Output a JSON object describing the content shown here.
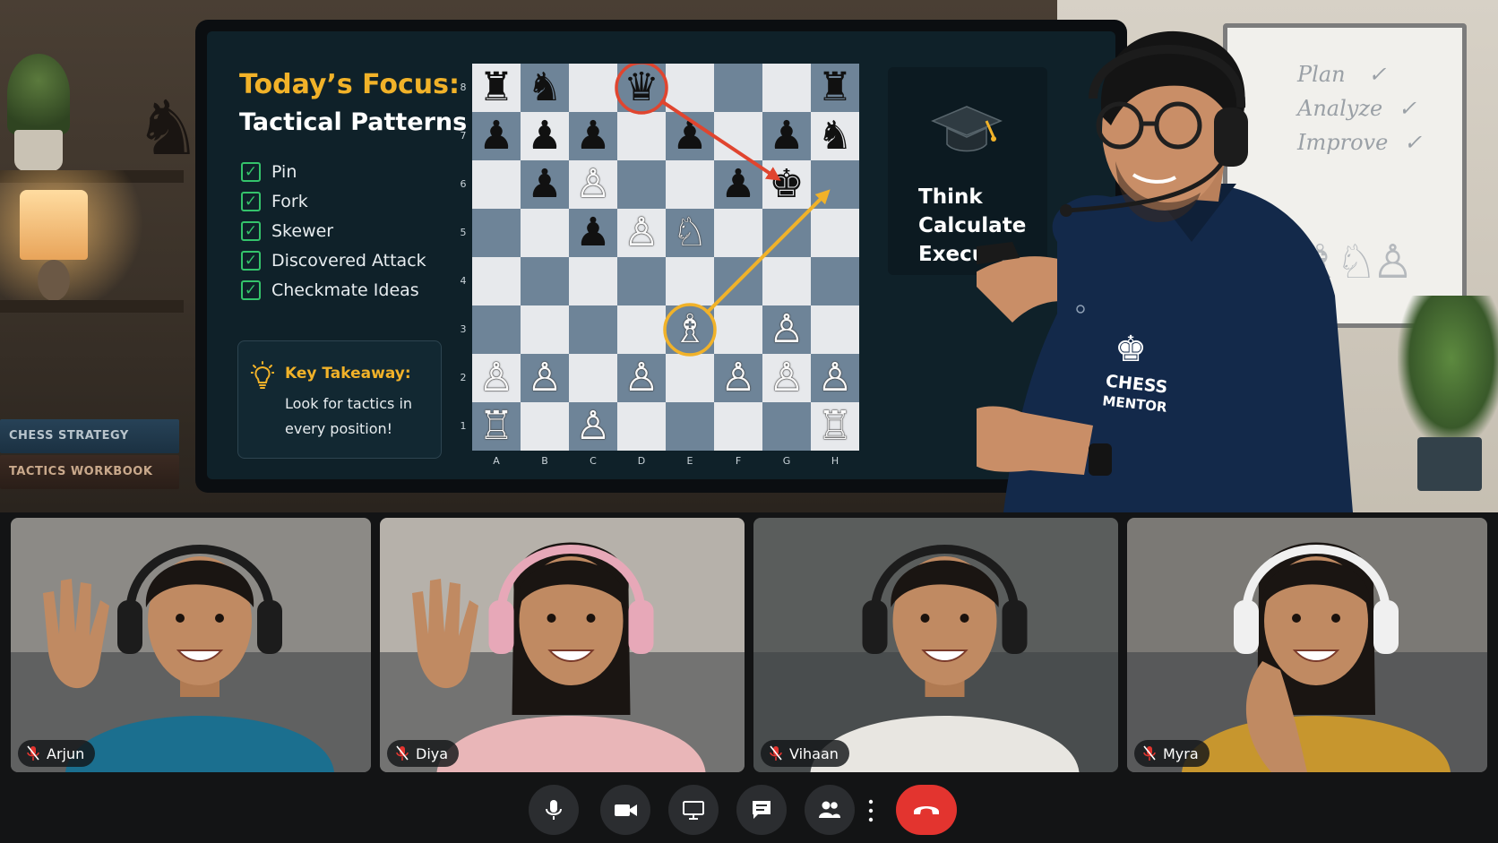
{
  "lesson": {
    "title": "Today’s Focus:",
    "subtitle": "Tactical Patterns",
    "topics": [
      "Pin",
      "Fork",
      "Skewer",
      "Discovered Attack",
      "Checkmate Ideas"
    ],
    "takeaway_title": "Key Takeaway:",
    "takeaway_body": "Look for tactics in every position!",
    "mantra": [
      "Think",
      "Calculate",
      "Execute"
    ]
  },
  "board": {
    "files": [
      "A",
      "B",
      "C",
      "D",
      "E",
      "F",
      "G",
      "H"
    ],
    "ranks": [
      "8",
      "7",
      "6",
      "5",
      "4",
      "3",
      "2",
      "1"
    ],
    "pieces": [
      {
        "sq": "a8",
        "glyph": "♜",
        "color": "b"
      },
      {
        "sq": "b8",
        "glyph": "♞",
        "color": "b"
      },
      {
        "sq": "d8",
        "glyph": "♛",
        "color": "b"
      },
      {
        "sq": "h8",
        "glyph": "♜",
        "color": "b"
      },
      {
        "sq": "a7",
        "glyph": "♟",
        "color": "b"
      },
      {
        "sq": "b7",
        "glyph": "♟",
        "color": "b"
      },
      {
        "sq": "c7",
        "glyph": "♟",
        "color": "b"
      },
      {
        "sq": "e7",
        "glyph": "♟",
        "color": "b"
      },
      {
        "sq": "g7",
        "glyph": "♟",
        "color": "b"
      },
      {
        "sq": "h7",
        "glyph": "♞",
        "color": "b"
      },
      {
        "sq": "b6",
        "glyph": "♟",
        "color": "b"
      },
      {
        "sq": "c6",
        "glyph": "♙",
        "color": "w"
      },
      {
        "sq": "f6",
        "glyph": "♟",
        "color": "b"
      },
      {
        "sq": "g6",
        "glyph": "♚",
        "color": "b"
      },
      {
        "sq": "c5",
        "glyph": "♟",
        "color": "b"
      },
      {
        "sq": "d5",
        "glyph": "♙",
        "color": "w"
      },
      {
        "sq": "e5",
        "glyph": "♘",
        "color": "w"
      },
      {
        "sq": "e3",
        "glyph": "♗",
        "color": "w"
      },
      {
        "sq": "g3",
        "glyph": "♙",
        "color": "w"
      },
      {
        "sq": "a2",
        "glyph": "♙",
        "color": "w"
      },
      {
        "sq": "b2",
        "glyph": "♙",
        "color": "w"
      },
      {
        "sq": "d2",
        "glyph": "♙",
        "color": "w"
      },
      {
        "sq": "f2",
        "glyph": "♙",
        "color": "w"
      },
      {
        "sq": "g2",
        "glyph": "♙",
        "color": "w"
      },
      {
        "sq": "h2",
        "glyph": "♙",
        "color": "w"
      },
      {
        "sq": "a1",
        "glyph": "♖",
        "color": "w"
      },
      {
        "sq": "c1",
        "glyph": "♙",
        "color": "w"
      },
      {
        "sq": "h1",
        "glyph": "♖",
        "color": "w"
      }
    ],
    "highlights": [
      {
        "sq": "d8",
        "color": "#e0452f"
      },
      {
        "sq": "e3",
        "color": "#f1b229"
      }
    ],
    "arrows": [
      {
        "from": "d8",
        "to": "g6",
        "color": "#e0452f"
      },
      {
        "from": "e3",
        "to": "h6",
        "color": "#f1b229"
      }
    ]
  },
  "room": {
    "books": [
      "CHESS STRATEGY",
      "TACTICS WORKBOOK"
    ],
    "whiteboard": [
      "Plan",
      "Analyze",
      "Improve"
    ],
    "whiteboard_mark": "✓",
    "shirt_lines": [
      "CHESS",
      "MENTOR"
    ]
  },
  "participants": [
    {
      "name": "Arjun",
      "shirt": "#1b6f8f",
      "headphones": "#1c1c1c",
      "bg": "#8c8a86",
      "hand": true
    },
    {
      "name": "Diya",
      "shirt": "#e9b6b8",
      "headphones": "#e7a8b8",
      "bg": "#b6b1aa",
      "hand": true
    },
    {
      "name": "Vihaan",
      "shirt": "#e8e6e1",
      "headphones": "#1c1c1c",
      "bg": "#5a5d5c",
      "hand": false
    },
    {
      "name": "Myra",
      "shirt": "#c7962e",
      "headphones": "#f0f0f0",
      "bg": "#7b7975",
      "hand": false
    }
  ],
  "controls": [
    "microphone",
    "camera",
    "present-screen",
    "chat",
    "participants",
    "more",
    "end-call"
  ],
  "colors": {
    "accent": "#f1b229",
    "check": "#34c36b",
    "end_call": "#e3342f",
    "screen_bg": "#0f2129"
  }
}
